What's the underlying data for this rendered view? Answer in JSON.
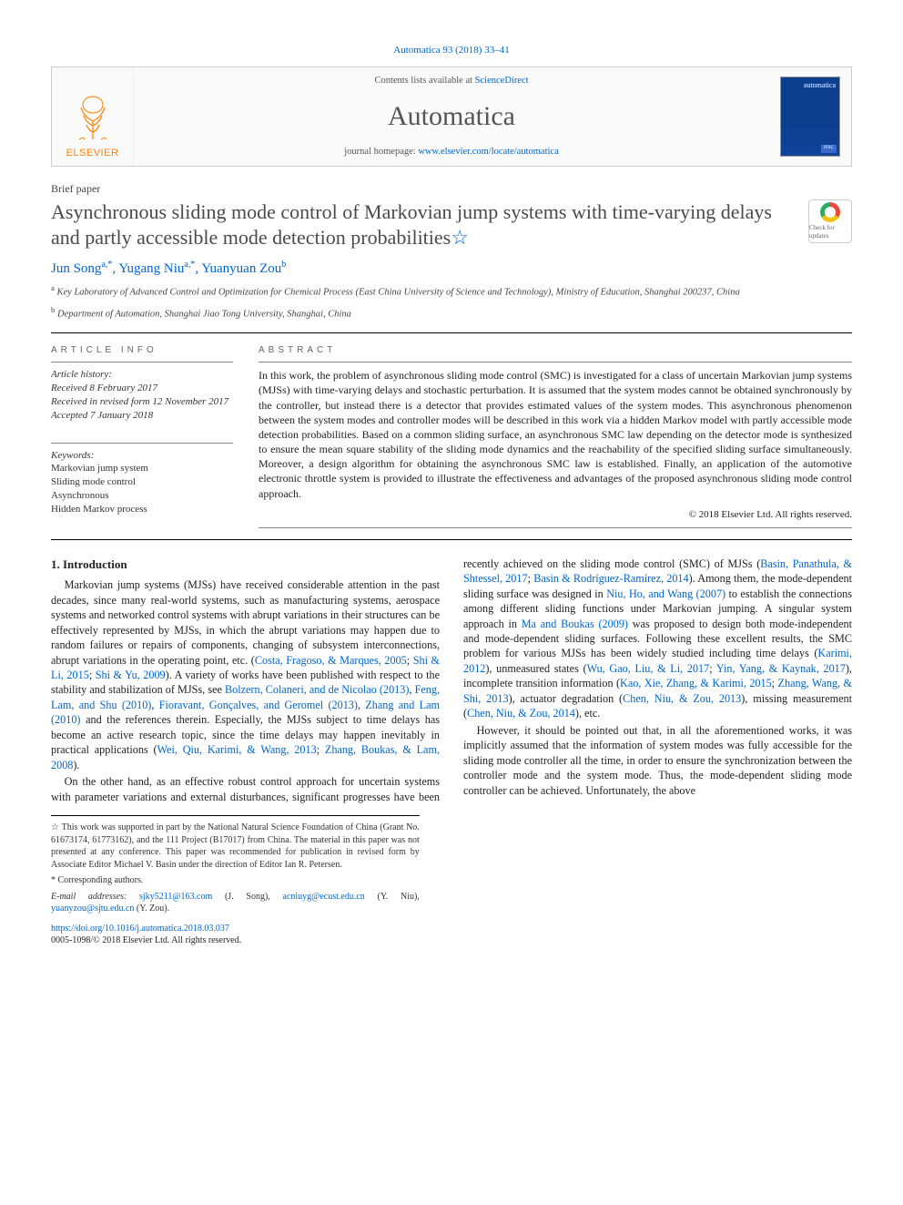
{
  "citation": "Automatica 93 (2018) 33–41",
  "banner": {
    "contents_prefix": "Contents lists available at ",
    "contents_link": "ScienceDirect",
    "journal": "Automatica",
    "homepage_prefix": "journal homepage: ",
    "homepage_url": "www.elsevier.com/locate/automatica",
    "publisher": "ELSEVIER",
    "cover_label": "automatica",
    "cover_badge": "IFAC"
  },
  "article_type": "Brief paper",
  "title": "Asynchronous sliding mode control of Markovian jump systems with time-varying delays and partly accessible mode detection probabilities",
  "title_note": "☆",
  "crossmark_label": "Check for updates",
  "authors_html": "Jun Song",
  "authors": [
    {
      "name": "Jun Song",
      "sup": "a,*"
    },
    {
      "name": "Yugang Niu",
      "sup": "a,*"
    },
    {
      "name": "Yuanyuan Zou",
      "sup": "b"
    }
  ],
  "affiliations": [
    {
      "sup": "a",
      "text": "Key Laboratory of Advanced Control and Optimization for Chemical Process (East China University of Science and Technology), Ministry of Education, Shanghai 200237, China"
    },
    {
      "sup": "b",
      "text": "Department of Automation, Shanghai Jiao Tong University, Shanghai, China"
    }
  ],
  "info": {
    "heading": "ARTICLE INFO",
    "history_label": "Article history:",
    "history": [
      "Received 8 February 2017",
      "Received in revised form 12 November 2017",
      "Accepted 7 January 2018"
    ],
    "keywords_label": "Keywords:",
    "keywords": [
      "Markovian jump system",
      "Sliding mode control",
      "Asynchronous",
      "Hidden Markov process"
    ]
  },
  "abstract": {
    "heading": "ABSTRACT",
    "text": "In this work, the problem of asynchronous sliding mode control (SMC) is investigated for a class of uncertain Markovian jump systems (MJSs) with time-varying delays and stochastic perturbation. It is assumed that the system modes cannot be obtained synchronously by the controller, but instead there is a detector that provides estimated values of the system modes. This asynchronous phenomenon between the system modes and controller modes will be described in this work via a hidden Markov model with partly accessible mode detection probabilities. Based on a common sliding surface, an asynchronous SMC law depending on the detector mode is synthesized to ensure the mean square stability of the sliding mode dynamics and the reachability of the specified sliding surface simultaneously. Moreover, a design algorithm for obtaining the asynchronous SMC law is established. Finally, an application of the automotive electronic throttle system is provided to illustrate the effectiveness and advantages of the proposed asynchronous sliding mode control approach.",
    "copyright": "© 2018 Elsevier Ltd. All rights reserved."
  },
  "section1_heading": "1. Introduction",
  "body": {
    "p1a": "Markovian jump systems (MJSs) have received considerable attention in the past decades, since many real-world systems, such as manufacturing systems, aerospace systems and networked control systems with abrupt variations in their structures can be effectively represented by MJSs, in which the abrupt variations may happen due to random failures or repairs of components, changing of subsystem interconnections, abrupt variations in the operating point, etc. (",
    "c1": "Costa, Fragoso, & Marques, 2005",
    "s1": "; ",
    "c2": "Shi & Li, 2015",
    "s2": "; ",
    "c3": "Shi & Yu, 2009",
    "p1b": "). A variety of works have been published with respect to the stability and stabilization of MJSs, see ",
    "c4": "Bolzern, Colaneri, and de Nicolao (2013)",
    "s3": ", ",
    "c5": "Feng, Lam, and Shu (2010)",
    "s4": ", ",
    "c6": "Fioravant, Gonçalves, and Geromel (2013)",
    "s5": ", ",
    "c7": "Zhang and Lam (2010)",
    "p1c": " and the references therein. Especially, the MJSs subject to time delays has become an active research topic, since the time delays may happen inevitably",
    "p1d": "in practical applications (",
    "c8": "Wei, Qiu, Karimi, & Wang, 2013",
    "s6": "; ",
    "c9": "Zhang, Boukas, & Lam, 2008",
    "p1e": ").",
    "p2a": "On the other hand, as an effective robust control approach for uncertain systems with parameter variations and external disturbances, significant progresses have been recently achieved on the sliding mode control (SMC) of MJSs (",
    "c10": "Basin, Panathula, & Shtessel, 2017",
    "s7": "; ",
    "c11": "Basin & Rodríguez-Ramírez, 2014",
    "p2b": "). Among them, the mode-dependent sliding surface was designed in ",
    "c12": "Niu, Ho, and Wang (2007)",
    "p2c": " to establish the connections among different sliding functions under Markovian jumping. A singular system approach in ",
    "c13": "Ma and Boukas (2009)",
    "p2d": " was proposed to design both mode-independent and mode-dependent sliding surfaces. Following these excellent results, the SMC problem for various MJSs has been widely studied including time delays (",
    "c14": "Karimi, 2012",
    "p2e": "), unmeasured states (",
    "c15": "Wu, Gao, Liu, & Li, 2017",
    "s8": "; ",
    "c16": "Yin, Yang, & Kaynak, 2017",
    "p2f": "), incomplete transition information (",
    "c17": "Kao, Xie, Zhang, & Karimi, 2015",
    "s9": "; ",
    "c18": "Zhang, Wang, & Shi, 2013",
    "p2g": "), actuator degradation (",
    "c19": "Chen, Niu, & Zou, 2013",
    "p2h": "), missing measurement (",
    "c20": "Chen, Niu, & Zou, 2014",
    "p2i": "), etc.",
    "p3": "However, it should be pointed out that, in all the aforementioned works, it was implicitly assumed that the information of system modes was fully accessible for the sliding mode controller all the time, in order to ensure the synchronization between the controller mode and the system mode. Thus, the mode-dependent sliding mode controller can be achieved. Unfortunately, the above"
  },
  "footnotes": {
    "note": "This work was supported in part by the National Natural Science Foundation of China (Grant No. 61673174, 61773162), and the 111 Project (B17017) from China. The material in this paper was not presented at any conference. This paper was recommended for publication in revised form by Associate Editor Michael V. Basin under the direction of Editor Ian R. Petersen.",
    "corr": "Corresponding authors.",
    "email_label": "E-mail addresses: ",
    "emails": [
      {
        "addr": "sjky5211@163.com",
        "who": "(J. Song)"
      },
      {
        "addr": "acniuyg@ecust.edu.cn",
        "who": "(Y. Niu)"
      },
      {
        "addr": "yuanyzou@sjtu.edu.cn",
        "who": "(Y. Zou)"
      }
    ]
  },
  "doi": {
    "url": "https://doi.org/10.1016/j.automatica.2018.03.037",
    "issn_line": "0005-1098/© 2018 Elsevier Ltd. All rights reserved."
  }
}
